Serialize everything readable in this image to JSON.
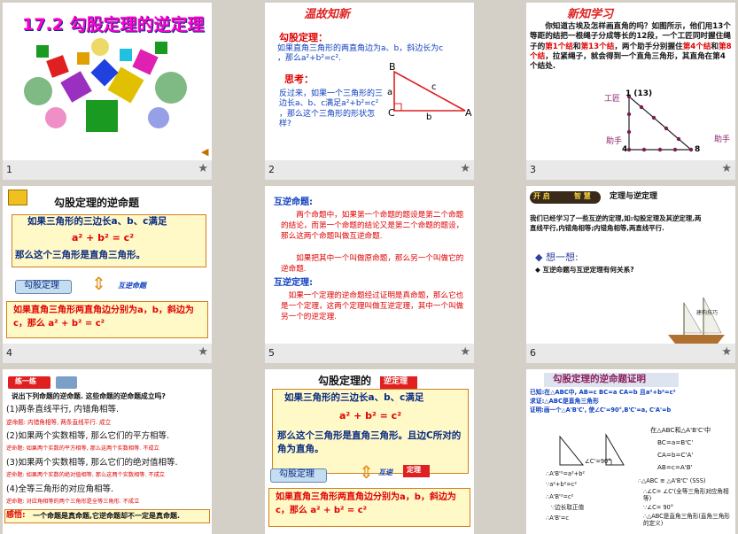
{
  "slides": [
    {
      "num": "1",
      "title": "17.2  勾股定理的逆定理"
    },
    {
      "num": "2",
      "heading": "温故知新",
      "theorem_title": "勾股定理：",
      "theorem_text": "如果直角三角形的两直角边为a、b，斜边长为c ，那么a²+b²=c².",
      "think_title": "思考：",
      "think_text": "反过来，如果一个三角形的三边长a、b、c满足a²+b²=c² ，那么这个三角形的形状怎样?",
      "vertex_b": "B",
      "vertex_c": "C",
      "vertex_a": "A",
      "side_a": "a",
      "side_b": "b",
      "side_c": "c"
    },
    {
      "num": "3",
      "heading": "新知学习",
      "text_part1": "你知道古埃及怎样画直角的吗？如图所示，他们用13个等距的结把一根绳子分成等长的12段，一个工匠同时握住绳子的",
      "highlight1": "第1个结",
      "text_part2": "和",
      "highlight2": "第13个结",
      "text_part3": "，两个助手分别握住",
      "highlight3": "第4个结",
      "text_part4": "和",
      "highlight4": "第8个结",
      "text_part5": "，拉紧绳子，就会得到一个直角三角形，其直角在第4个结处.",
      "label_worker": "工匠",
      "label_knot1": "1 (13)",
      "label_helper1": "助手",
      "label_helper2": "助手",
      "label_knot4": "4",
      "label_knot8": "8"
    },
    {
      "num": "4",
      "title": "勾股定理的逆命题",
      "line1": "如果三角形的三边长a、b、c满足",
      "formula": "a² + b² = c²",
      "line2": "那么这个三角形是直角三角形。",
      "btn": "勾股定理",
      "arrow_text": "互逆命题",
      "bottom": "如果直角三角形两直角边分别为a，b，斜边为c，那么  a² + b² = c²"
    },
    {
      "num": "5",
      "title1": "互逆命题:",
      "text1": "两个命题中，如果第一个命题的题设是第二个命题的结论，而第一个命题的结论又是第二个命题的题设，那么这两个命题叫做互逆命题.",
      "text2": "如果把其中一个叫做原命题，那么另一个叫做它的逆命题.",
      "title2": "互逆定理:",
      "text3": "如果一个定理的逆命题经过证明是真命题，那么它也是一个定理，这两个定理叫做互逆定理，其中一个叫做另一个的逆定理."
    },
    {
      "num": "6",
      "badge_left": "开 启",
      "badge_right": "智 慧",
      "title": "定理与逆定理",
      "text": "我们已经学习了一些互逆的定理,如:勾股定理及其逆定理,两直线平行,内错角相等;内错角相等,两直线平行.",
      "think": "想一想:",
      "question": "互逆命题与互逆定理有何关系?",
      "ship_caption": "建构技巧"
    },
    {
      "num": "",
      "badge": "练一练",
      "intro": "说出下列命题的逆命题. 这些命题的逆命题成立吗?",
      "items": [
        "(1)两条直线平行, 内错角相等.",
        "(2)如果两个实数相等, 那么它们的平方相等.",
        "(3)如果两个实数相等, 那么它们的绝对值相等.",
        "(4)全等三角形的对应角相等."
      ],
      "answers": [
        "逆命题: 内错角相等, 两条直线平行.  成立",
        "逆命题: 如果两个实数的平方相等, 那么这两个实数相等.  不成立",
        "逆命题: 如果两个实数的绝对值相等, 那么这两个实数相等.  不成立",
        "逆命题: 对应角相等的两个三角形是全等三角形.  不成立"
      ],
      "insight_label": "感悟:",
      "insight": "一个命题是真命题,它逆命题却不一定是真命题."
    },
    {
      "num": "",
      "title": "勾股定理的",
      "tag": "逆定理",
      "line1": "如果三角形的三边长a、b、c满足",
      "formula": "a² + b² = c²",
      "line2": "那么这个三角形是直角三角形。且边C所对的角为直角。",
      "btn": "勾股定理",
      "arrow_text": "互逆",
      "tag2": "定理",
      "bottom": "如果直角三角形两直角边分别为a，b，斜边为c，那么  a² + b² = c²"
    },
    {
      "num": "",
      "title": "勾股定理的逆命题证明",
      "given": "已知:在△ABC中, AB=c BC=a CA=b 且a²+b²=c²",
      "prove": "求证:△ABC是直角三角形",
      "proof_head": "证明:画一个△A'B'C', 使∠C'=90°,B'C'=a, C'A'=b",
      "right_head": "在△ABC和△A'B'C'中",
      "eq1": "BC=a=B'C'",
      "eq2": "CA=b=C'A'",
      "eq3": "AB=c=A'B'",
      "angle": "∠C'=90°",
      "l1": "∴A'B'²=a²+b²",
      "l2": "∵a²+b²=c²",
      "l3": "∴A'B'²=c²",
      "l4": "∵边长取正值",
      "l5": "∴A'B'=c",
      "r1": "∴△ABC ≌ △A'B'C' (SSS)",
      "r2": "∴∠C= ∠C'(全等三角形对应角相等)",
      "r3": "∵∠C= 90°",
      "r4": "∴△ABC是直角三角形(直角三角形的定义)"
    }
  ]
}
